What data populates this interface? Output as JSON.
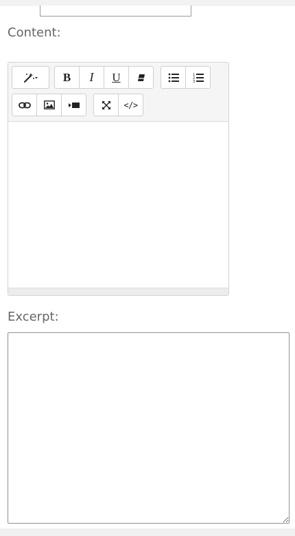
{
  "form": {
    "content_label": "Content:",
    "excerpt_label": "Excerpt:",
    "excerpt_value": "",
    "excerpt_placeholder": ""
  },
  "editor": {
    "content_value": "",
    "toolbar": {
      "row1": [
        {
          "name": "style-magic-wand-dropdown",
          "icon": "magic-wand-icon"
        },
        {
          "name": "bold-button",
          "label": "B",
          "icon": "bold-icon"
        },
        {
          "name": "italic-button",
          "label": "I",
          "icon": "italic-icon"
        },
        {
          "name": "underline-button",
          "label": "U",
          "icon": "underline-icon"
        },
        {
          "name": "clear-format-button",
          "icon": "eraser-icon"
        },
        {
          "name": "unordered-list-button",
          "icon": "bullet-list-icon"
        },
        {
          "name": "ordered-list-button",
          "icon": "numbered-list-icon"
        }
      ],
      "row2": [
        {
          "name": "insert-link-button",
          "icon": "link-icon"
        },
        {
          "name": "insert-image-button",
          "icon": "image-icon"
        },
        {
          "name": "insert-video-button",
          "icon": "video-icon"
        },
        {
          "name": "fullscreen-button",
          "icon": "expand-icon"
        },
        {
          "name": "code-view-button",
          "label": "</>",
          "icon": "code-icon"
        }
      ]
    }
  },
  "colors": {
    "background": "#f0f0f0",
    "panel": "#ffffff",
    "label_text": "#666666",
    "toolbar_bg": "#f5f5f5",
    "button_border": "#cfcfcf"
  }
}
